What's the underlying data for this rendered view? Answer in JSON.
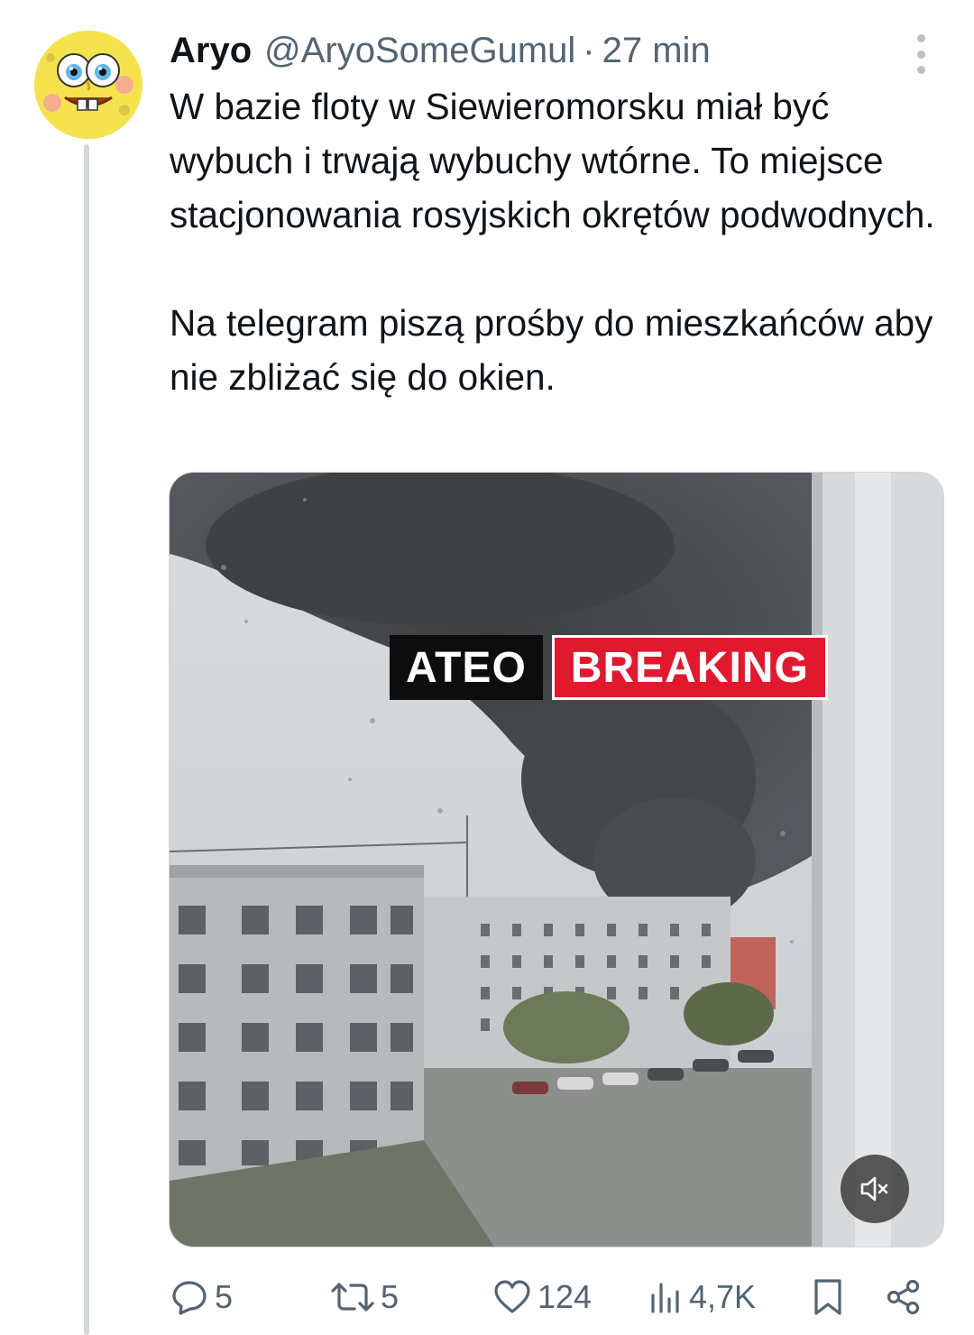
{
  "tweet": {
    "author": {
      "name": "Aryo",
      "handle": "@AryoSomeGumul",
      "separator": "·",
      "time": "27 min",
      "avatar_icon": "spongebob-avatar-icon"
    },
    "text": {
      "paragraph1": "W bazie floty w Siewieromorsku miał być wybuch i trwają wybuchy wtórne. To miejsce stacjonowania rosyjskich okrętów podwodnych.",
      "paragraph2": "Na telegram piszą prośby do mieszkańców aby nie zbliżać się do okien."
    },
    "media": {
      "type": "video",
      "overlay_left": "ATEO",
      "overlay_right": "BREAKING",
      "mute_icon": "speaker-muted-icon"
    },
    "actions": {
      "replies": "5",
      "reposts": "5",
      "likes": "124",
      "views": "4,7K"
    }
  },
  "colors": {
    "text": "#0f1419",
    "muted": "#536471",
    "breaking_red": "#e0192f",
    "thread_line": "#cfd9de"
  }
}
